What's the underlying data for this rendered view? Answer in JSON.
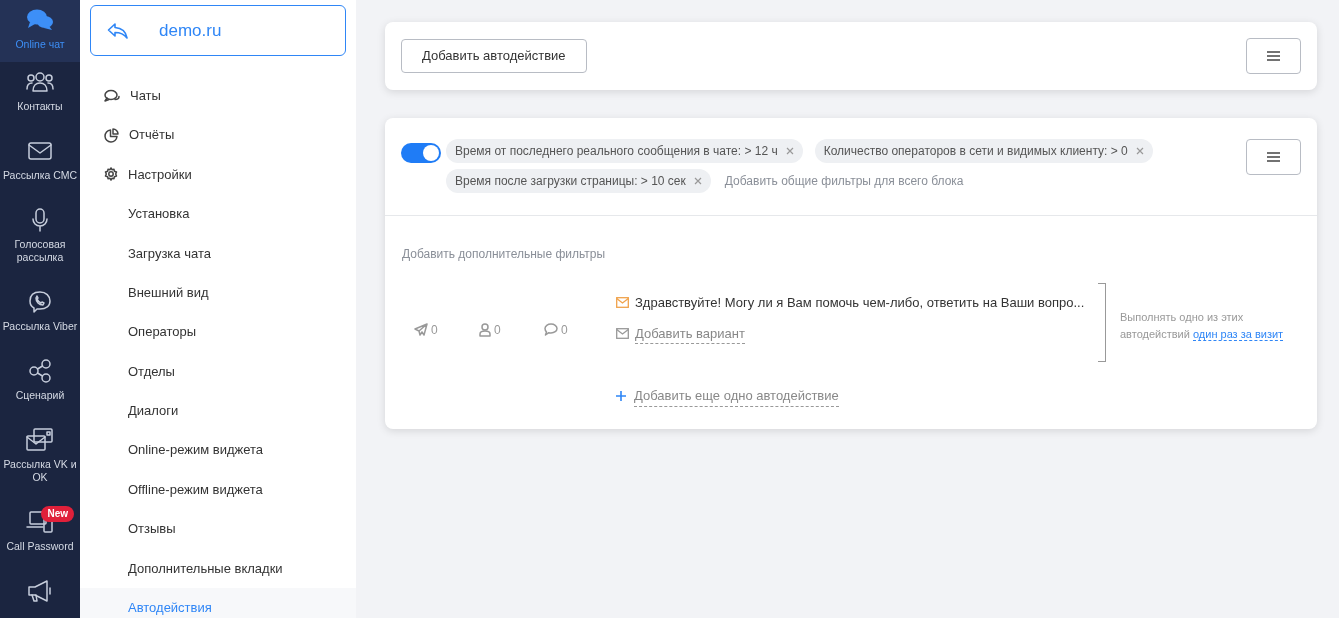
{
  "nav": [
    {
      "label": "Online чат",
      "selected": true
    },
    {
      "label": "Контакты",
      "selected": false
    },
    {
      "label": "Рассылка СМС",
      "selected": false
    },
    {
      "label": "Голосовая рассылка",
      "selected": false
    },
    {
      "label": "Рассылка Viber",
      "selected": false
    },
    {
      "label": "Сценарий",
      "selected": false
    },
    {
      "label": "Рассылка VK и OK",
      "selected": false
    },
    {
      "label": "Call Password",
      "selected": false,
      "badge": "New"
    },
    {
      "selected": false
    }
  ],
  "site": {
    "title": "demo.ru"
  },
  "menu": [
    {
      "label": "Чаты",
      "selected": false
    },
    {
      "label": "Отчёты",
      "selected": false
    },
    {
      "label": "Настройки",
      "selected": false,
      "children": [
        {
          "label": "Установка",
          "selected": false
        },
        {
          "label": "Загрузка чата",
          "selected": false
        },
        {
          "label": "Внешний вид",
          "selected": false
        },
        {
          "label": "Операторы",
          "selected": false
        },
        {
          "label": "Отделы",
          "selected": false
        },
        {
          "label": "Диалоги",
          "selected": false
        },
        {
          "label": "Online-режим виджета",
          "selected": false
        },
        {
          "label": "Offline-режим виджета",
          "selected": false
        },
        {
          "label": "Отзывы",
          "selected": false
        },
        {
          "label": "Дополнительные вкладки",
          "selected": false
        },
        {
          "label": "Автодействия",
          "selected": true
        }
      ]
    }
  ],
  "toolbar": {
    "add_button": "Добавить автодействие"
  },
  "block": {
    "enabled": true,
    "filters": [
      "Время от последнего реального сообщения в чате: > 12 ч",
      "Количество операторов в сети и видимых клиенту: > 0",
      "Время после загрузки страницы: > 10 сек"
    ],
    "add_common_filters": "Добавить общие фильтры для всего блока",
    "add_extra_filters": "Добавить дополнительные фильтры",
    "stats": [
      "0",
      "0",
      "0"
    ],
    "messages": [
      "Здравствуйте! Могу ли я Вам помочь чем-либо, ответить на Ваши вопро..."
    ],
    "add_variant": "Добавить вариант",
    "add_action": "Добавить еще одно автодействие",
    "rule_text": "Выполнять одно из этих автодействий",
    "rule_link": "один раз за визит"
  }
}
